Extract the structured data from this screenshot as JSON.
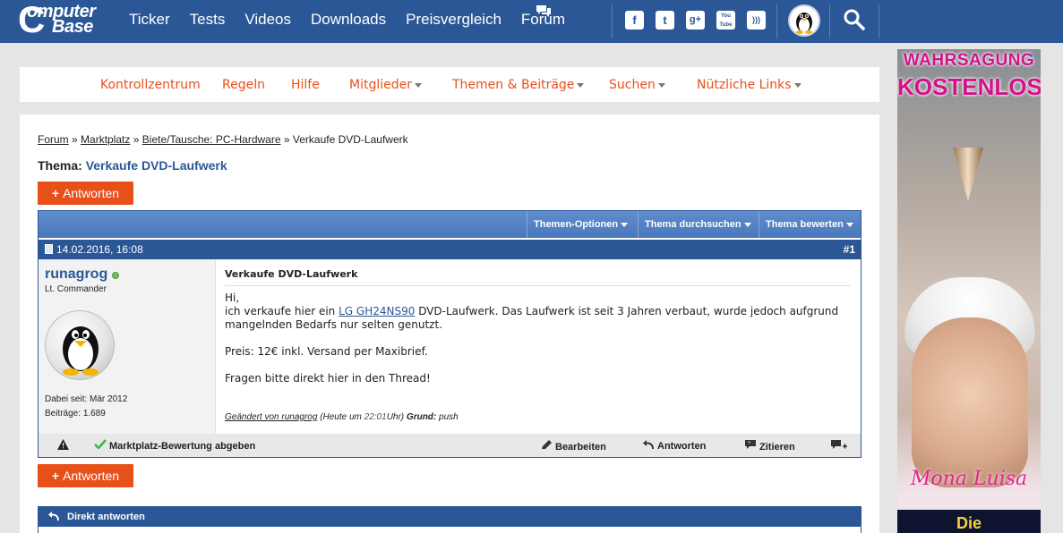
{
  "header": {
    "logo_line1": "omputer",
    "logo_line2": "Base",
    "logo_c": "C",
    "nav": [
      "Ticker",
      "Tests",
      "Videos",
      "Downloads",
      "Preisvergleich",
      "Forum"
    ],
    "social_icons": [
      "facebook-icon",
      "twitter-icon",
      "google-plus-icon",
      "youtube-icon",
      "rss-icon"
    ],
    "social_glyphs": [
      "f",
      "t",
      "g+",
      "You Tube",
      ")))"
    ]
  },
  "subnav": {
    "items": [
      "Kontrollzentrum",
      "Regeln",
      "Hilfe",
      "Mitglieder",
      "Themen & Beiträge",
      "Suchen",
      "Nützliche Links"
    ]
  },
  "breadcrumb": {
    "items": [
      "Forum",
      "Marktplatz",
      "Biete/Tausche: PC-Hardware"
    ],
    "current": "Verkaufe DVD-Laufwerk",
    "sep": "»"
  },
  "thread": {
    "label": "Thema:",
    "title": "Verkaufe DVD-Laufwerk",
    "reply_button": "Antworten",
    "tools": [
      "Themen-Optionen",
      "Thema durchsuchen",
      "Thema bewerten"
    ]
  },
  "post": {
    "date": "14.02.2016, 16:08",
    "number": "#1",
    "user": {
      "name": "runagrog",
      "rank": "Lt. Commander",
      "joined_label": "Dabei seit:",
      "joined": "Mär 2012",
      "posts_label": "Beiträge:",
      "posts": "1.689"
    },
    "title": "Verkaufe DVD-Laufwerk",
    "greeting": "Hi,",
    "line1_pre": "ich verkaufe hier ein ",
    "link": "LG GH24NS90",
    "line1_post": " DVD-Laufwerk. Das Laufwerk ist seit 3 Jahren verbaut, wurde jedoch aufgrund mangelnden Bedarfs nur selten genutzt.",
    "price": "Preis: 12€ inkl. Versand per Maxibrief.",
    "questions": "Fragen bitte direkt hier in den Thread!",
    "edited_pre": "Geändert von runagrog",
    "edited_time_pre": "(Heute um",
    "edited_time": "22:01",
    "edited_time_post": "Uhr)",
    "reason_label": "Grund:",
    "reason": "push"
  },
  "actions": {
    "rating": "Marktplatz-Bewertung abgeben",
    "edit": "Bearbeiten",
    "reply": "Antworten",
    "quote": "Zitieren"
  },
  "quick_reply": {
    "title": "Direkt antworten"
  },
  "ad": {
    "line1": "WAHRSAGUNG",
    "line2": "KOSTENLOS",
    "signature": "Mona Luisa",
    "bottom": "Die"
  }
}
